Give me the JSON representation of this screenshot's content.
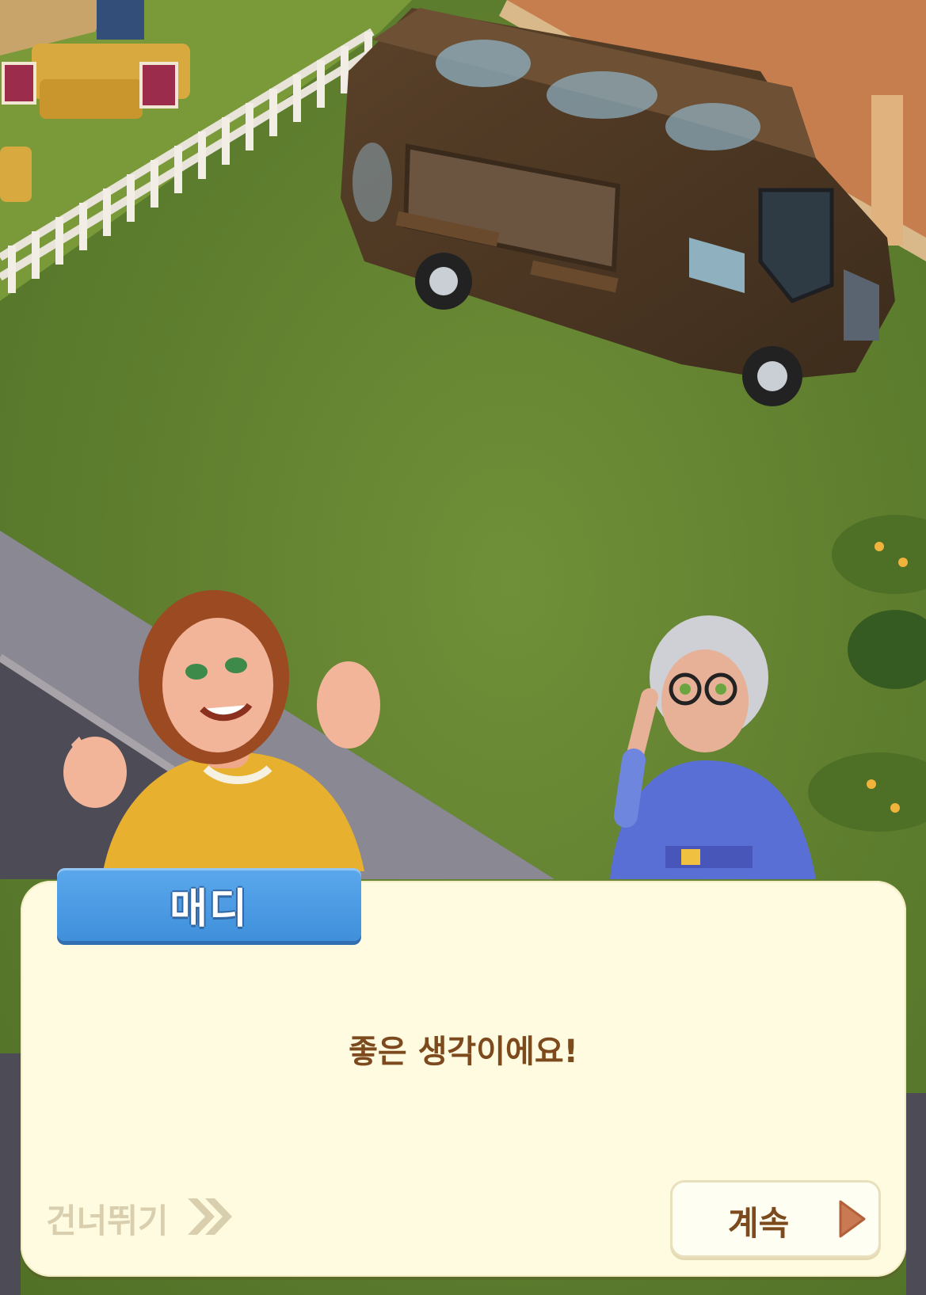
{
  "dialog": {
    "speaker": "매디",
    "line": "좋은 생각이에요!",
    "skip_label": "건너뛰기",
    "continue_label": "계속"
  },
  "icons": {
    "skip": "double-chevron-right-icon",
    "continue": "play-arrow-icon"
  },
  "colors": {
    "nameplate": "#4a9be3",
    "dialog_bg": "#fffbe0",
    "dialog_text": "#7d4a1e",
    "skip_text": "#d9cfae",
    "grass": "#5f7f2e"
  }
}
